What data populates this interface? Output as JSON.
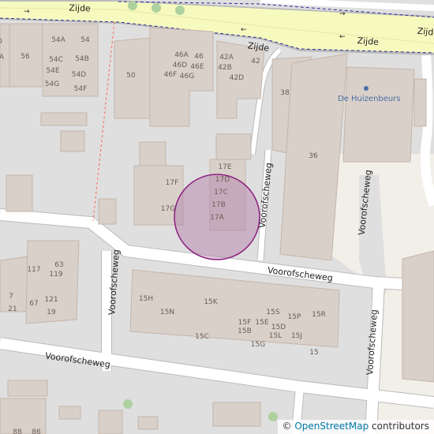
{
  "map": {
    "street_labels": {
      "zijde_top": "Zijde",
      "zijde_right": "Zijde",
      "zijde_far_right": "Zijde",
      "zijde_small": "Zijde",
      "voorofscheweg_vertical_center": "Voorofscheweg",
      "voorofscheweg_horizontal": "Voorofscheweg",
      "voorofscheweg_vertical_left": "Voorofscheweg",
      "voorofscheweg_bottom": "Voorofscheweg",
      "voorofscheweg_right_upper": "Voorofscheweg",
      "voorofscheweg_right_lower": "Voorofscheweg"
    },
    "house_numbers": {
      "n0": "0",
      "nA": "A",
      "n56": "56",
      "n54A": "54A",
      "n54": "54",
      "n54C": "54C",
      "n54B": "54B",
      "n54E": "54E",
      "n54D": "54D",
      "n54G": "54G",
      "n54F": "54F",
      "n50": "50",
      "n46A": "46A",
      "n46": "46",
      "n46D": "46D",
      "n46E": "46E",
      "n46F": "46F",
      "n46G": "46G",
      "n42A": "42A",
      "n42": "42",
      "n42B": "42B",
      "n42D": "42D",
      "n38": "38",
      "n36": "36",
      "n17E": "17E",
      "n17D": "17D",
      "n17F": "17F",
      "n17C": "17C",
      "n17B": "17B",
      "n17G": "17G",
      "n17A": "17A",
      "n117": "117",
      "n63": "63",
      "n119": "119",
      "n7": "7",
      "n21": "21",
      "n67": "67",
      "n121": "121",
      "n19": "19",
      "n15H": "15H",
      "n15K": "15K",
      "n15N": "15N",
      "n15S": "15S",
      "n15P": "15P",
      "n15R": "15R",
      "n15F": "15F",
      "n15E": "15E",
      "n15D": "15D",
      "n15B": "15B",
      "n15C": "15C",
      "n15L": "15L",
      "n15J": "15J",
      "n15G": "15G",
      "n15": "15",
      "n88": "88",
      "n86": "86"
    },
    "poi": {
      "label": "De Huizenbeurs"
    },
    "colors": {
      "background": "#e0dfdf",
      "building": "#d9d0c9",
      "road": "#ffffff",
      "primary_road": "#f7fabf",
      "marker_fill": "#b07aa9",
      "marker_stroke": "#8c1e7f",
      "tree": "#aed1a0",
      "bus_lane": "#2a2a9a"
    }
  },
  "attribution": {
    "symbol": "©",
    "link_text": "OpenStreetMap",
    "suffix": "contributors"
  }
}
